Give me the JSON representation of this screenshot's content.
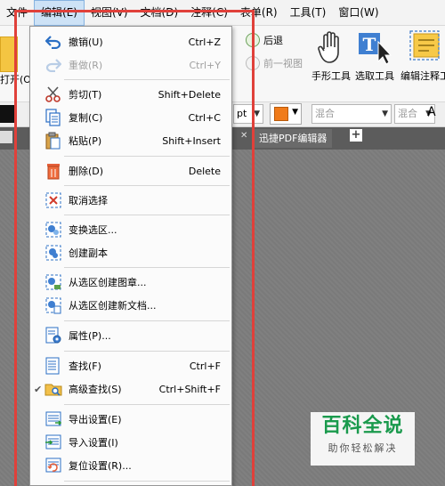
{
  "menubar": {
    "items": [
      "文件",
      "编辑(E)",
      "视图(V)",
      "文档(D)",
      "注释(C)",
      "表单(R)",
      "工具(T)",
      "窗口(W)"
    ],
    "active_index": 1
  },
  "ribbon": {
    "left_label": "打开(O)",
    "back_label": "后退",
    "prev_view_label": "前一视图",
    "hand_tool": "手形工具",
    "select_tool": "选取工具",
    "annot_tool": "编辑注释工"
  },
  "toolbar2": {
    "unit": "pt",
    "blend1": "混合",
    "blend2": "混合",
    "font_letter": "A"
  },
  "tabs": {
    "doc_title": "迅捷PDF编辑器",
    "close": "✕",
    "plus": "+"
  },
  "dropdown": {
    "items": [
      {
        "label": "撤销(U)",
        "shortcut": "Ctrl+Z",
        "icon": "undo-icon",
        "disabled": false
      },
      {
        "label": "重做(R)",
        "shortcut": "Ctrl+Y",
        "icon": "redo-icon",
        "disabled": true
      },
      {
        "label": "剪切(T)",
        "shortcut": "Shift+Delete",
        "icon": "scissors-icon",
        "disabled": false
      },
      {
        "label": "复制(C)",
        "shortcut": "Ctrl+C",
        "icon": "copy-icon",
        "disabled": false
      },
      {
        "label": "粘贴(P)",
        "shortcut": "Shift+Insert",
        "icon": "paste-icon",
        "disabled": false
      },
      {
        "label": "删除(D)",
        "shortcut": "Delete",
        "icon": "trash-icon",
        "disabled": false
      },
      {
        "label": "取消选择",
        "shortcut": "",
        "icon": "deselect-icon",
        "disabled": false
      },
      {
        "label": "变换选区...",
        "shortcut": "",
        "icon": "transform-selection-icon",
        "disabled": false
      },
      {
        "label": "创建副本",
        "shortcut": "",
        "icon": "duplicate-icon",
        "disabled": false
      },
      {
        "label": "从选区创建图章...",
        "shortcut": "",
        "icon": "stamp-icon",
        "disabled": false
      },
      {
        "label": "从选区创建新文档...",
        "shortcut": "",
        "icon": "new-doc-icon",
        "disabled": false
      },
      {
        "label": "属性(P)...",
        "shortcut": "",
        "icon": "properties-icon",
        "disabled": false
      },
      {
        "label": "查找(F)",
        "shortcut": "Ctrl+F",
        "icon": "find-icon",
        "disabled": false
      },
      {
        "label": "高级查找(S)",
        "shortcut": "Ctrl+Shift+F",
        "icon": "advanced-find-icon",
        "disabled": false,
        "checked": true
      },
      {
        "label": "导出设置(E)",
        "shortcut": "",
        "icon": "export-settings-icon",
        "disabled": false
      },
      {
        "label": "导入设置(I)",
        "shortcut": "",
        "icon": "import-settings-icon",
        "disabled": false
      },
      {
        "label": "复位设置(R)...",
        "shortcut": "",
        "icon": "reset-settings-icon",
        "disabled": false
      }
    ],
    "check_glyph": "✔"
  },
  "watermark": {
    "title": "百科全说",
    "subtitle": "助你轻松解决"
  },
  "colors": {
    "accent_red": "#e0403a",
    "menu_highlight": "#cde2f6",
    "watermark_green": "#1a9a4d"
  }
}
